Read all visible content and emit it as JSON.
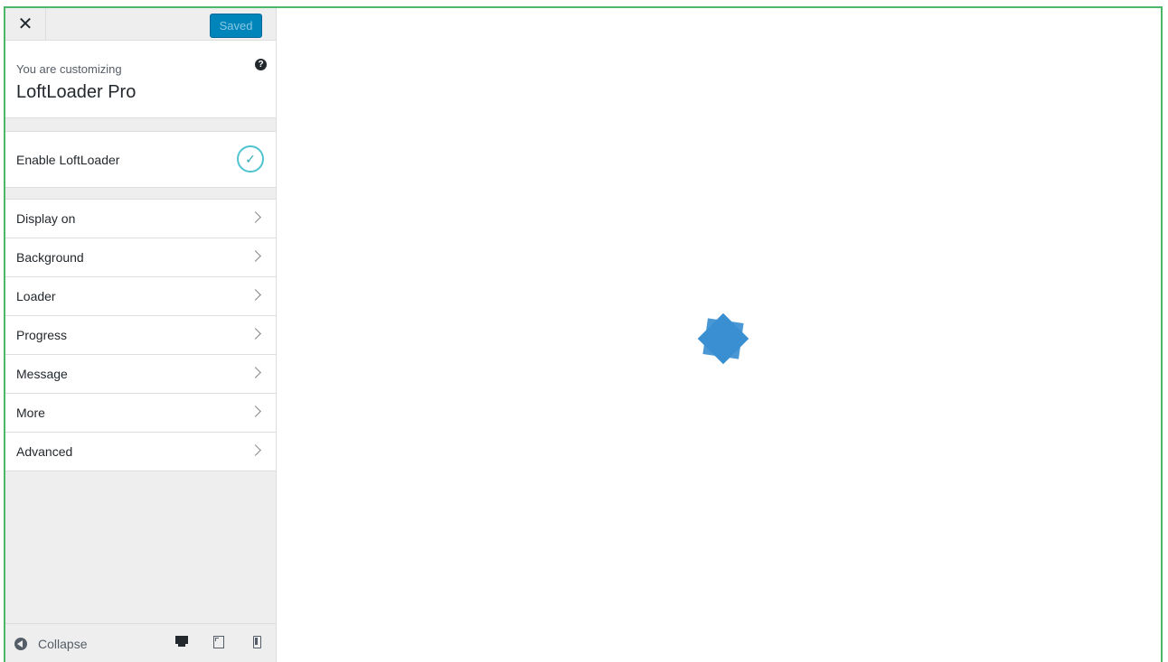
{
  "header": {
    "close_glyph": "✕",
    "saved_label": "Saved"
  },
  "info": {
    "subtitle": "You are customizing",
    "title": "LoftLoader Pro",
    "help_glyph": "?"
  },
  "enable": {
    "label": "Enable LoftLoader",
    "checked": true,
    "check_glyph": "✓",
    "accent_color": "#4fc3cf"
  },
  "menu": {
    "items": [
      {
        "label": "Display on"
      },
      {
        "label": "Background"
      },
      {
        "label": "Loader"
      },
      {
        "label": "Progress"
      },
      {
        "label": "Message"
      },
      {
        "label": "More"
      },
      {
        "label": "Advanced"
      }
    ]
  },
  "footer": {
    "collapse_label": "Collapse",
    "devices": [
      "desktop-icon",
      "tablet-icon",
      "mobile-icon"
    ],
    "active_device": "desktop"
  },
  "preview": {
    "loader_color": "#3a8fd1",
    "frame_color": "#4ab866"
  }
}
